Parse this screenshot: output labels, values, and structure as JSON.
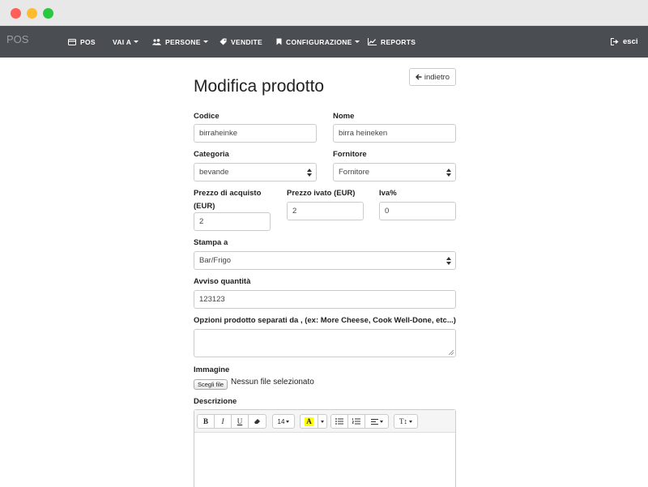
{
  "nav": {
    "brand": "POS",
    "items": [
      {
        "label": "POS",
        "icon": "credit-card-icon"
      },
      {
        "label": "VAI A",
        "caret": true
      },
      {
        "label": "PERSONE",
        "icon": "users-icon",
        "caret": true
      },
      {
        "label": "VENDITE",
        "icon": "tag-icon"
      },
      {
        "label": "CONFIGURAZIONE",
        "icon": "bookmark-icon",
        "caret": true
      },
      {
        "label": "REPORTS",
        "icon": "line-chart-icon"
      }
    ],
    "logout_label": "esci"
  },
  "page": {
    "title": "Modifica prodotto",
    "back_label": "indietro"
  },
  "form": {
    "codice": {
      "label": "Codice",
      "value": "birraheinke"
    },
    "nome": {
      "label": "Nome",
      "value": "birra heineken"
    },
    "categoria": {
      "label": "Categoria",
      "value": "bevande"
    },
    "fornitore": {
      "label": "Fornitore",
      "value": "Fornitore"
    },
    "prezzo_acquisto": {
      "label_line1": "Prezzo di acquisto",
      "label_line2": "(EUR)",
      "value": "2"
    },
    "prezzo_ivato": {
      "label": "Prezzo ivato (EUR)",
      "value": "2"
    },
    "iva": {
      "label": "Iva%",
      "value": "0"
    },
    "stampa": {
      "label": "Stampa a",
      "value": "Bar/Frigo"
    },
    "avviso": {
      "label": "Avviso quantità",
      "value": "123123"
    },
    "opzioni": {
      "label": "Opzioni prodotto separati da , (ex: More Cheese, Cook Well-Done, etc...)",
      "value": ""
    },
    "immagine": {
      "label": "Immagine",
      "button": "Scegli file",
      "status": "Nessun file selezionato"
    },
    "descrizione": {
      "label": "Descrizione"
    }
  },
  "editor_toolbar": {
    "bold": "B",
    "italic": "I",
    "underline": "U",
    "font_size": "14",
    "color_letter": "A",
    "text_height": "T↕"
  },
  "colors": {
    "navbar": "#4a4d52",
    "highlight": "#ffff00"
  }
}
